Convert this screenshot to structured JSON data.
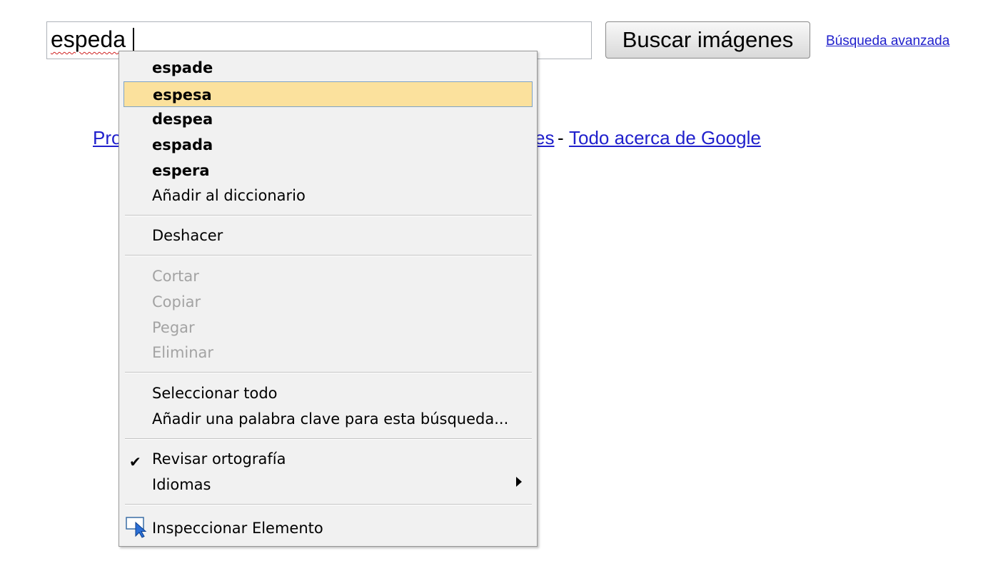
{
  "search": {
    "value_misspelled": "espeda",
    "button_label": "Buscar imágenes",
    "advanced_link": "Búsqueda avanzada"
  },
  "background_links": {
    "left_fragment": "Pro",
    "middle_fragment": "es",
    "separator": "-",
    "about": "Todo acerca de Google"
  },
  "menu": {
    "suggestions": [
      "espade",
      "espesa",
      "despea",
      "espada",
      "espera"
    ],
    "add_to_dictionary": "Añadir al diccionario",
    "undo": "Deshacer",
    "cut": "Cortar",
    "copy": "Copiar",
    "paste": "Pegar",
    "delete": "Eliminar",
    "select_all": "Seleccionar todo",
    "add_keyword": "Añadir una palabra clave para esta búsqueda...",
    "check_spelling": "Revisar ortografía",
    "languages": "Idiomas",
    "inspect": "Inspeccionar Elemento"
  }
}
